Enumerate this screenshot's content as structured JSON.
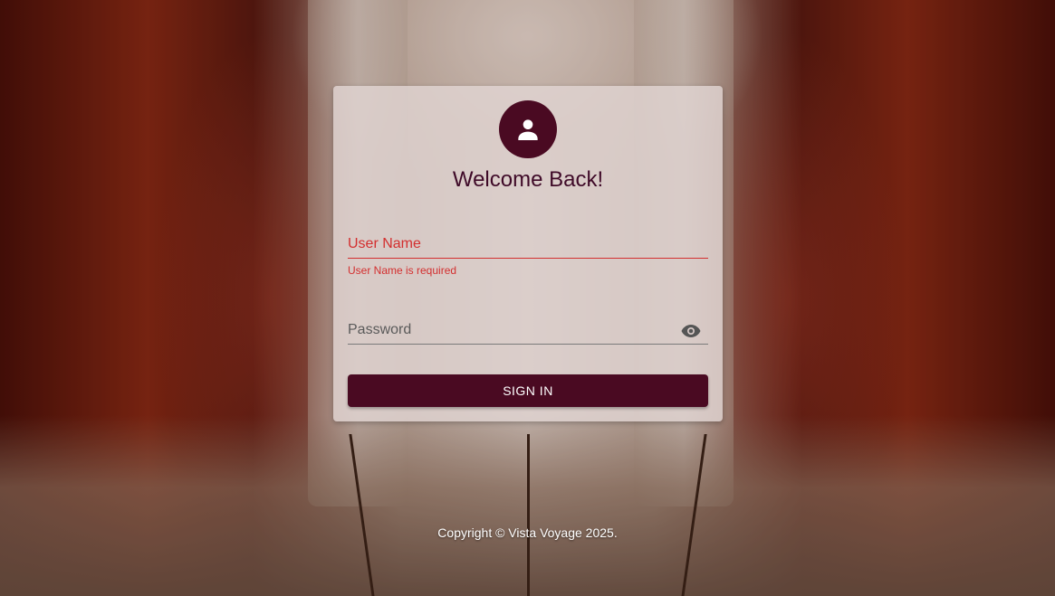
{
  "login": {
    "title": "Welcome Back!",
    "username": {
      "placeholder": "User Name",
      "value": "",
      "error": "User Name is required"
    },
    "password": {
      "placeholder": "Password",
      "value": ""
    },
    "submit_label": "SIGN IN"
  },
  "footer": {
    "copyright": "Copyright © Vista Voyage 2025."
  },
  "colors": {
    "brand": "#4a0a22",
    "error": "#d32f2f"
  },
  "icons": {
    "avatar": "person-icon",
    "toggle_password": "eye-icon"
  }
}
